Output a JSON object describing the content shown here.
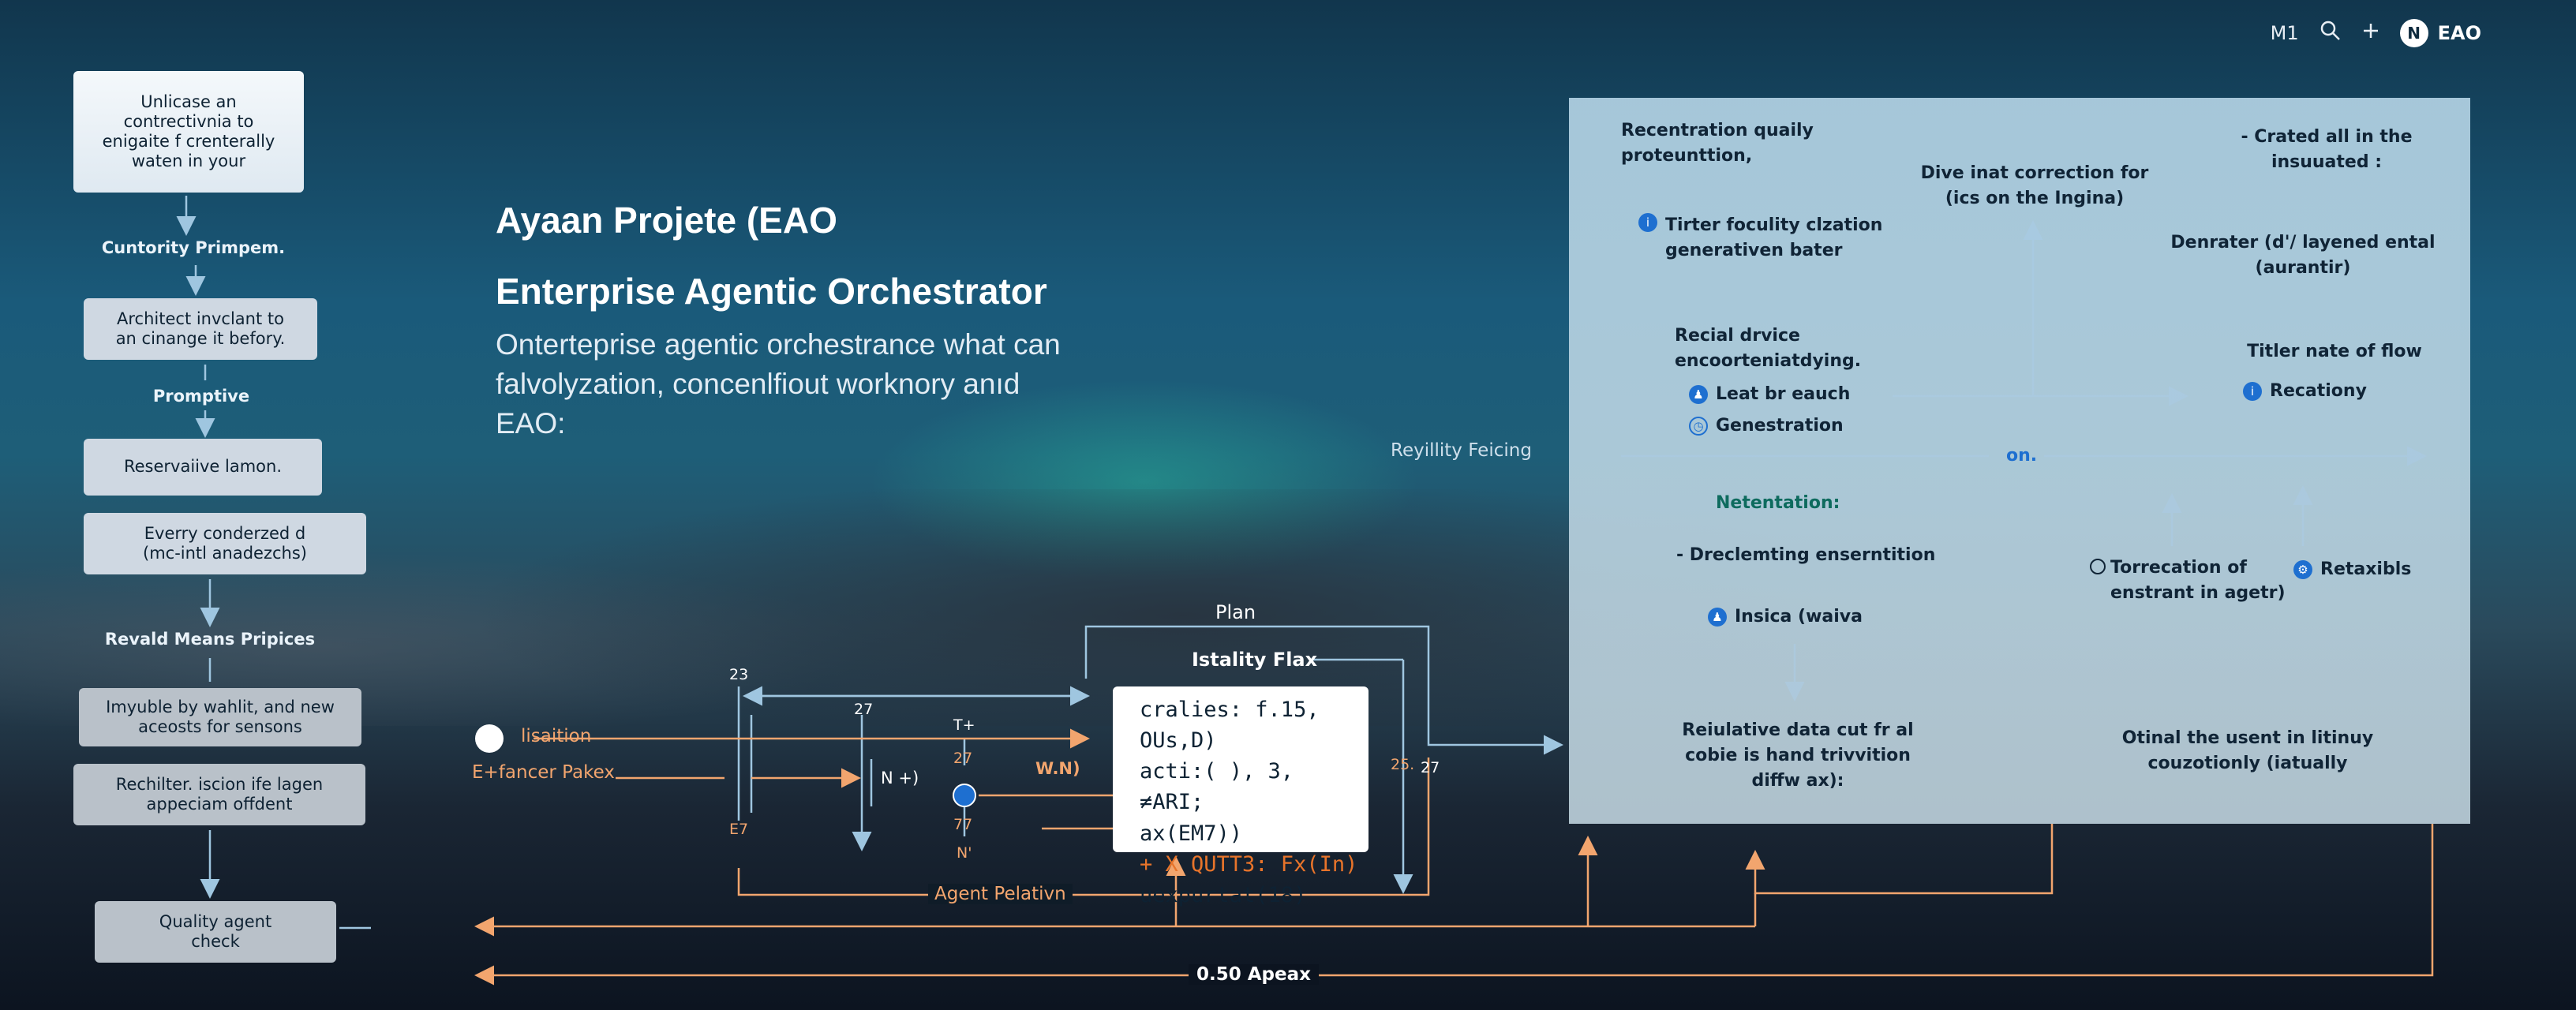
{
  "header": {
    "version": "M1",
    "search_icon": "search-icon",
    "add_icon": "plus-icon",
    "avatar_letter": "N",
    "brand": "EAO"
  },
  "flow": {
    "boxes": [
      "Unlicase an\ncontrectivnia to\nenigaite f crenterally\nwaten in your",
      "Architect invclant to\nan cinange it befory.",
      "Reservaiive lamon.",
      "Everry conderzed d\n(mc-intl anadezchs)",
      "Imyuble by wahlit, and new\naceosts for sensons",
      "Rechilter. iscion ife lagen\nappeciam offdent",
      "Quality agent\ncheck"
    ],
    "labels": [
      "Cuntority Primpem.",
      "Promptive",
      "Revald Means Pripices"
    ]
  },
  "hero": {
    "title": "Ayaan Projete (EAO",
    "subtitle": "Enterprise Agentic Orchestrator",
    "description": "Onterteprise agentic orchestrance what can falvolyzation,  concenlfiout worknory anıd EAO:"
  },
  "side_label": "Reyillity Feicing",
  "panel": {
    "t1": "Recentration quaily\nproteunttion,",
    "t2": "Dive inat correction for\n(ics on the Ingina)",
    "t3": "-  Crated all in the\ninsuuated :",
    "t4": "Tirter foculity clzation\ngenerativen bater",
    "t5": "Denrater (d'/ layened ental\n(aurantir)",
    "t6": "Recial drvice\nencoorteniatdying.",
    "t7": "Titler nate of flow",
    "b1": "Leat br eauch",
    "b2": "Genestration",
    "b3": "Recationy",
    "axis_label": "on.",
    "t8": "Netentation:",
    "t9": "-  Dreclemting enserntition",
    "t10": "Torrecation of\nenstrant in agetr)",
    "t11": "Retaxibls",
    "t12": "Insica (waiva",
    "t13": "Reiulative data cut fr al\ncobie is hand trivvition\ndiffw ax):",
    "t14": "Otinal the usent in litinuy\ncouzotionly (iatually"
  },
  "diagram": {
    "plan": "Plan",
    "istality": "Istality Flax",
    "lisaition": "lisaition",
    "enhancer": "E+fancer Pakex",
    "n23": "23",
    "n27a": "27",
    "n27b": "27",
    "n27c": "27",
    "n77": "77",
    "nT": "T+",
    "nN": "N +)",
    "nWN": "W.N)",
    "nNp": "N'",
    "n25": "25.",
    "n27d": "27",
    "ne7": "E7",
    "agent_relation": "Agent Pelativn",
    "apex": "0.50 Apeax",
    "code": [
      "cralies: f.15, OUs,D)",
      "acti:( ), 3, ≠ARI;",
      "ax(EM7))",
      "+ X  QUTT3: Fx(In)",
      "uexpurtat(18)"
    ]
  }
}
